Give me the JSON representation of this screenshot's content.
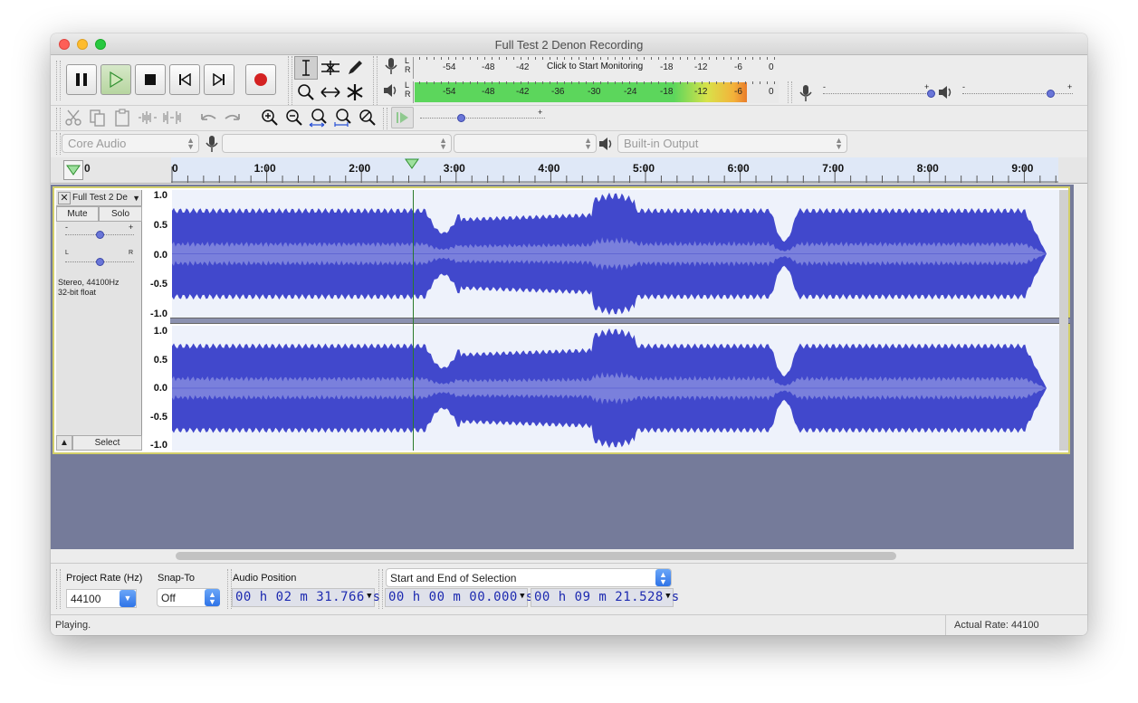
{
  "window": {
    "title": "Full Test 2 Denon Recording"
  },
  "meters": {
    "record_scale": [
      "-54",
      "-48",
      "-42",
      "-18",
      "-12",
      "-6",
      "0"
    ],
    "record_prompt": "Click to Start Monitoring",
    "play_scale": [
      "-54",
      "-48",
      "-42",
      "-36",
      "-30",
      "-24",
      "-18",
      "-12",
      "-6",
      "0"
    ],
    "play_level_fraction": 0.98,
    "lr": {
      "l": "L",
      "r": "R"
    }
  },
  "mixer": {
    "minus": "-",
    "plus": "+"
  },
  "device": {
    "host": "Core Audio",
    "output": "Built-in Output"
  },
  "ruler": {
    "start": "0",
    "labels": [
      "0",
      "1:00",
      "2:00",
      "3:00",
      "4:00",
      "5:00",
      "6:00",
      "7:00",
      "8:00",
      "9:00"
    ]
  },
  "track": {
    "name": "Full Test 2 De",
    "mute": "Mute",
    "solo": "Solo",
    "gain_minus": "-",
    "gain_plus": "+",
    "pan_l": "L",
    "pan_r": "R",
    "format_line1": "Stereo, 44100Hz",
    "format_line2": "32-bit float",
    "select": "Select",
    "vscale": [
      "1.0",
      "0.5",
      "0.0",
      "-0.5",
      "-1.0"
    ]
  },
  "selection_toolbar": {
    "project_rate_label": "Project Rate (Hz)",
    "project_rate": "44100",
    "snap_to_label": "Snap-To",
    "snap_to": "Off",
    "audio_position_label": "Audio Position",
    "audio_position": "00 h 02 m 31.766 s",
    "selection_mode": "Start and End of Selection",
    "selection_start": "00 h 00 m 00.000 s",
    "selection_end": "00 h 09 m 21.528 s"
  },
  "status": {
    "left": "Playing.",
    "right": "Actual Rate: 44100"
  },
  "colors": {
    "wave_dark": "#4148cc",
    "wave_light": "#7a80dc",
    "track_bg": "#757b9a",
    "ruler_bg": "#dfe8f7"
  }
}
